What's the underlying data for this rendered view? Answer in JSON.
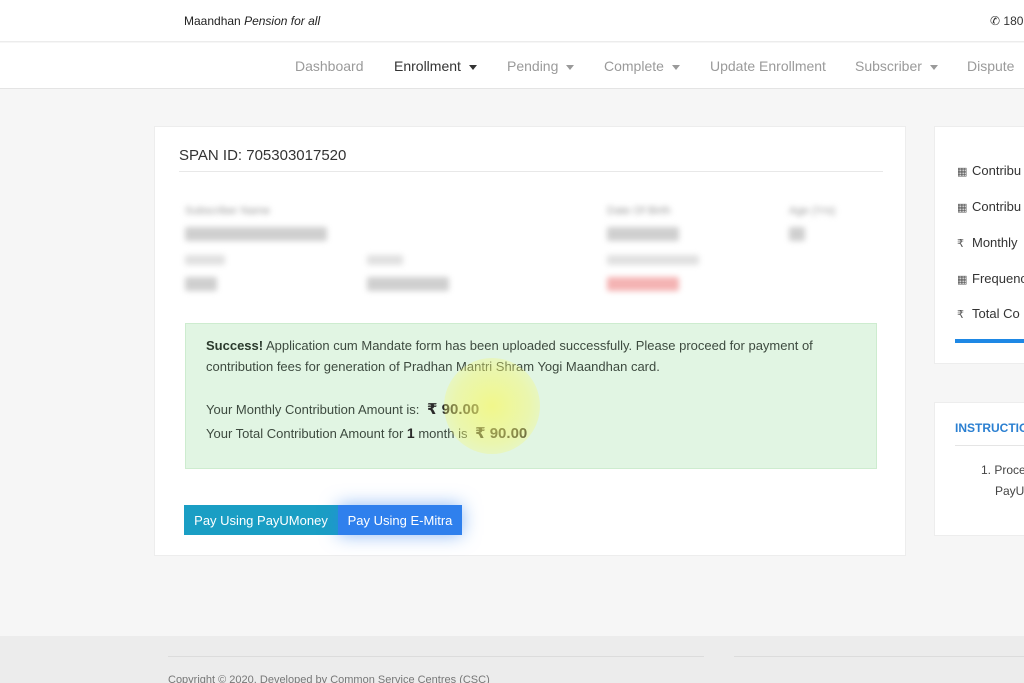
{
  "header": {
    "brand_prefix": "Maandhan",
    "brand_tagline": "Pension for all",
    "phone_icon": "phone-icon",
    "phone_partial": "180"
  },
  "nav": {
    "items": [
      {
        "label": "Dashboard",
        "dropdown": false
      },
      {
        "label": "Enrollment",
        "dropdown": true,
        "active": true
      },
      {
        "label": "Pending",
        "dropdown": true
      },
      {
        "label": "Complete",
        "dropdown": true
      },
      {
        "label": "Update Enrollment",
        "dropdown": false
      },
      {
        "label": "Subscriber",
        "dropdown": true
      },
      {
        "label": "Dispute",
        "dropdown": false
      }
    ]
  },
  "main": {
    "span_id": "SPAN ID: 705303017520",
    "blurred_labels": {
      "subscriber_name": "Subscriber Name",
      "date_of_birth": "Date Of Birth",
      "age": "Age (Yrs)"
    },
    "alert": {
      "strong": "Success!",
      "message": " Application cum Mandate form has been uploaded successfully. Please proceed for payment of contribution fees for generation of Pradhan Mantri Shram Yogi Maandhan card.",
      "monthly_label": "Your Monthly Contribution Amount is:",
      "monthly_value": "₹ 90.00",
      "total_label_prefix": "Your Total Contribution Amount for",
      "total_months": "1",
      "total_label_suffix": "month is",
      "total_value": "₹ 90.00"
    },
    "buttons": {
      "payumoney": "Pay Using PayUMoney",
      "emitra": "Pay Using E-Mitra"
    }
  },
  "sidebar": {
    "items": [
      {
        "icon": "calendar-icon",
        "glyph": "▦",
        "label": "Contribu"
      },
      {
        "icon": "calendar-icon",
        "glyph": "▦",
        "label": "Contribu"
      },
      {
        "icon": "rupee-icon",
        "glyph": "₹",
        "label": "Monthly"
      },
      {
        "icon": "calendar-icon",
        "glyph": "▦",
        "label": "Frequenc"
      },
      {
        "icon": "rupee-icon",
        "glyph": "₹",
        "label": "Total Co"
      }
    ],
    "instructions_title": "INSTRUCTIO",
    "instruction_line1": "1. Proce",
    "instruction_line2": "PayU"
  },
  "footer": {
    "copyright": "Copyright © 2020. Developed by Common Service Centres (CSC)"
  },
  "colors": {
    "alert_bg": "#e1f5e3",
    "payu_button": "#1a9ec4",
    "emitra_button": "#2f80ed",
    "accent_blue": "#1e88e5"
  }
}
